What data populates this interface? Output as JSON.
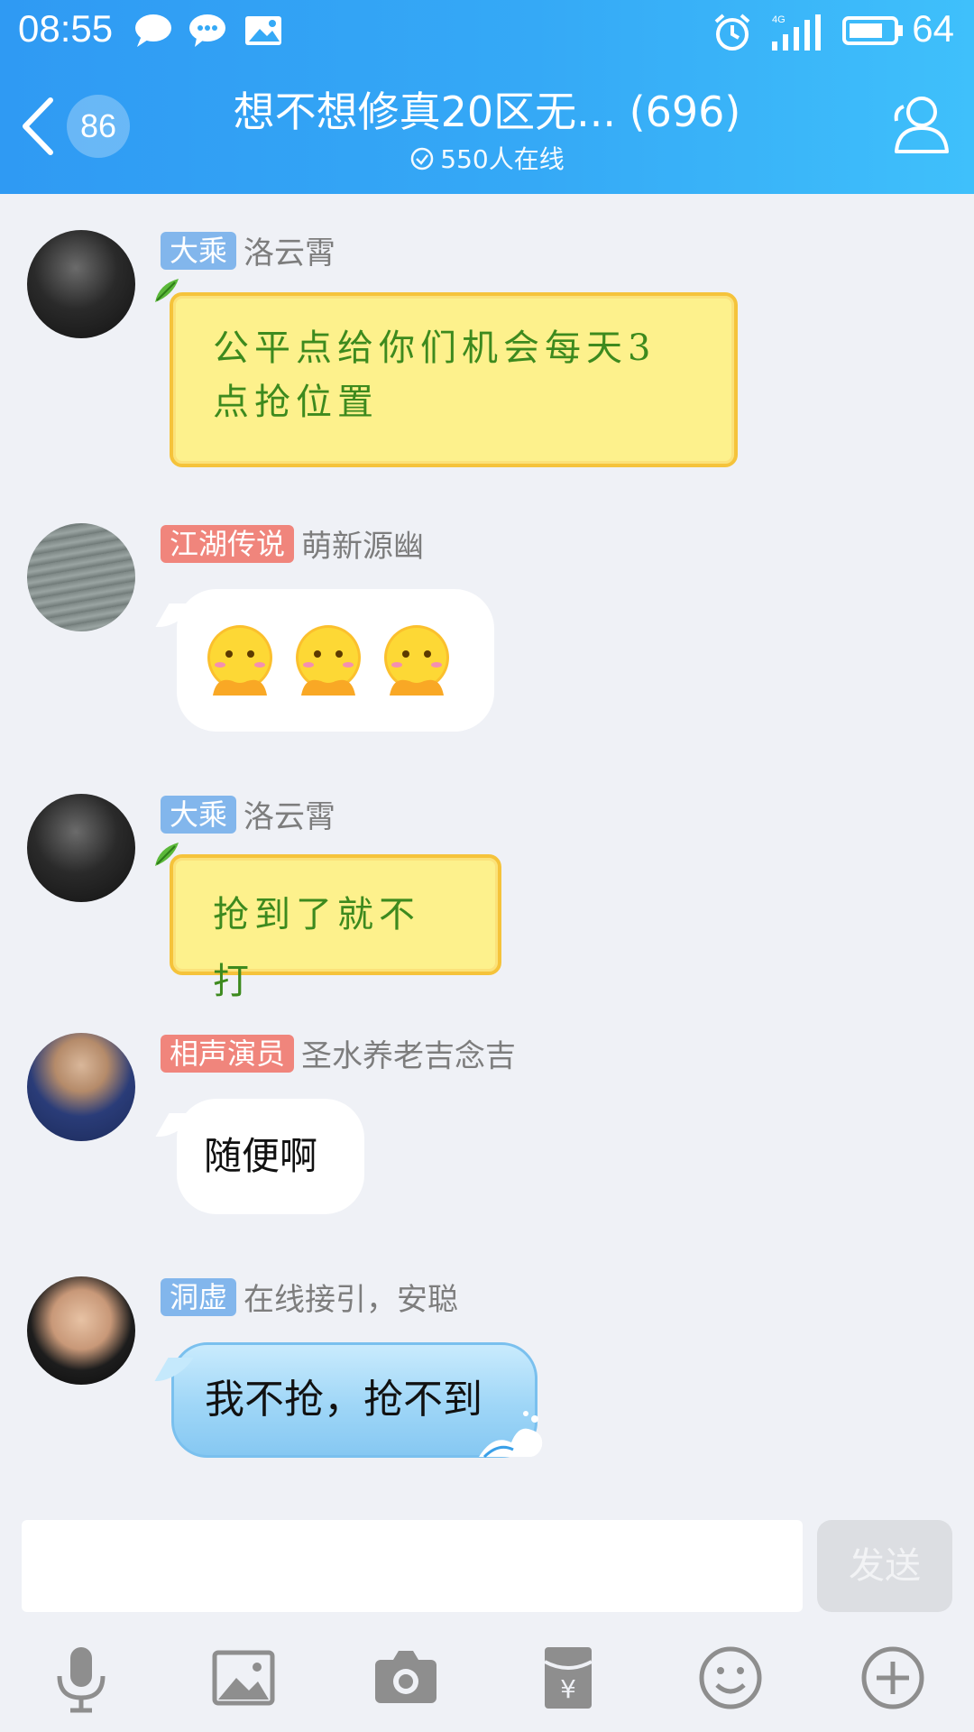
{
  "status_bar": {
    "time": "08:55",
    "battery": "64",
    "network": "4G"
  },
  "header": {
    "unread_count": "86",
    "title": "想不想修真20区无... (696)",
    "online": "550人在线"
  },
  "messages": [
    {
      "tag": "大乘",
      "tag_color": "#82b6ec",
      "name": "洛云霄",
      "type": "yellow-scroll",
      "text": "公平点给你们机会每天3点抢位置",
      "avatar": "dark-hooded-person"
    },
    {
      "tag": "江湖传说",
      "tag_color": "#f0857c",
      "name": "萌新源幽",
      "type": "emoji",
      "emoji": [
        "shy-face",
        "shy-face",
        "shy-face"
      ],
      "avatar": "water-surface"
    },
    {
      "tag": "大乘",
      "tag_color": "#82b6ec",
      "name": "洛云霄",
      "type": "yellow-scroll",
      "text": "抢到了就不打",
      "avatar": "dark-hooded-person"
    },
    {
      "tag": "相声演员",
      "tag_color": "#f0857c",
      "name": "圣水养老吉念吉",
      "type": "white",
      "text": "随便啊",
      "avatar": "football-player"
    },
    {
      "tag": "洞虚",
      "tag_color": "#82b6ec",
      "name": "在线接引，安聪",
      "type": "blue-wave",
      "text": "我不抢，抢不到",
      "avatar": "young-man"
    }
  ],
  "input": {
    "value": "",
    "placeholder": "",
    "send_label": "发送"
  },
  "toolbar": [
    "microphone-icon",
    "image-icon",
    "camera-icon",
    "red-packet-icon",
    "emoji-icon",
    "plus-icon"
  ]
}
